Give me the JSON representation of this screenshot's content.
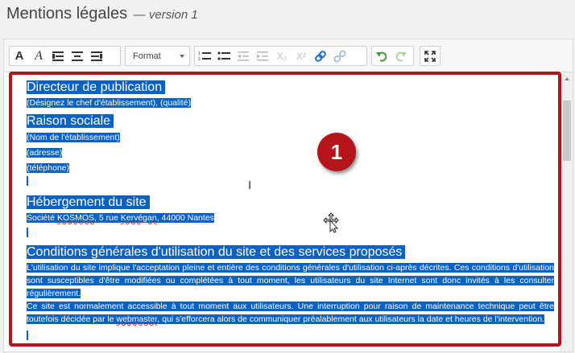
{
  "page": {
    "title": "Mentions légales",
    "version": "— version 1"
  },
  "toolbar": {
    "bold_icon": "A",
    "italic_icon": "A",
    "format_label": "Format",
    "subscript_label": "X₂",
    "superscript_label": "X²"
  },
  "content": {
    "h1": "Directeur de publication",
    "l1": "(Désignez le chef d'établissement), (qualité)",
    "h2": "Raison sociale",
    "l2": "(Nom de l'établissement)",
    "l3": "(adresse)",
    "l4": "(téléphone)",
    "h3": "Hébergement du site",
    "l5_pre": "Société ",
    "l5_kosmos": "KOSMOS",
    "l5_mid": ", 5 rue ",
    "l5_kervegan": "Kervégan",
    "l5_post": ", 44000 Nantes",
    "h4": "Conditions générales d'utilisation du site et des services proposés",
    "p1": "L'utilisation du site implique l'acceptation pleine et entière des conditions générales d'utilisation ci-après décrites. Ces conditions d'utilisation sont susceptibles d'être modifiées ou complétées à tout moment, les utilisateurs du site Internet sont donc invités à les consulter régulièrement.",
    "p2_pre": "Ce site est normalement accessible à tout moment aux utilisateurs. Une interruption pour raison de maintenance technique peut être toutefois décidée par le ",
    "p2_webmaster": "webmaster",
    "p2_post": ", qui s'efforcera alors de communiquer préalablement aux utilisateurs la date et heures de l'intervention."
  },
  "annotation": {
    "badge": "1"
  },
  "colors": {
    "selection": "#0a62c4",
    "annotation": "#b3151b"
  }
}
